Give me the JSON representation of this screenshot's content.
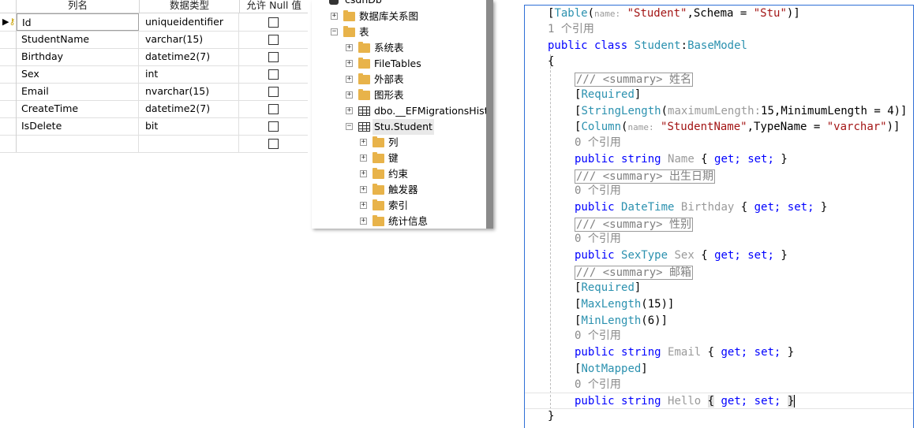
{
  "designer": {
    "headers": [
      "列名",
      "数据类型",
      "允许 Null 值"
    ],
    "rows": [
      {
        "name": "Id",
        "type": "uniqueidentifier",
        "nullable": false,
        "primary_key": true
      },
      {
        "name": "StudentName",
        "type": "varchar(15)",
        "nullable": false
      },
      {
        "name": "Birthday",
        "type": "datetime2(7)",
        "nullable": false
      },
      {
        "name": "Sex",
        "type": "int",
        "nullable": false
      },
      {
        "name": "Email",
        "type": "nvarchar(15)",
        "nullable": false
      },
      {
        "name": "CreateTime",
        "type": "datetime2(7)",
        "nullable": false
      },
      {
        "name": "IsDelete",
        "type": "bit",
        "nullable": false
      },
      {
        "name": "",
        "type": "",
        "nullable": false
      }
    ]
  },
  "tree": {
    "db_name": "csdnDb",
    "nodes": [
      {
        "label": "数据库关系图",
        "icon": "folder-icon"
      },
      {
        "label": "表",
        "icon": "folder-icon",
        "expanded": true
      },
      {
        "label": "系统表",
        "icon": "folder-icon"
      },
      {
        "label": "FileTables",
        "icon": "folder-icon"
      },
      {
        "label": "外部表",
        "icon": "folder-icon"
      },
      {
        "label": "图形表",
        "icon": "folder-icon"
      },
      {
        "label": "dbo.__EFMigrationsHistc",
        "icon": "table-icon"
      },
      {
        "label": "Stu.Student",
        "icon": "table-icon",
        "expanded": true
      },
      {
        "label": "列",
        "icon": "folder-icon"
      },
      {
        "label": "键",
        "icon": "folder-icon"
      },
      {
        "label": "约束",
        "icon": "folder-icon"
      },
      {
        "label": "触发器",
        "icon": "folder-icon"
      },
      {
        "label": "索引",
        "icon": "folder-icon"
      },
      {
        "label": "统计信息",
        "icon": "folder-icon"
      }
    ]
  },
  "code": {
    "table_attr": "Table",
    "name_hint": "name:",
    "table_name": "\"Student\"",
    "schema_text": ",Schema = ",
    "schema_value": "\"Stu\"",
    "ref_1": "1 个引用",
    "ref_0": "0 个引用",
    "kw_public": "public",
    "kw_class": "class",
    "class_name": "Student",
    "base_class": "BaseModel",
    "summary_prefix": "/// <summary>",
    "summary_name": "姓名",
    "summary_birthday": "出生日期",
    "summary_sex": "性别",
    "summary_email": "邮箱",
    "attr_required": "Required",
    "attr_stringlength": "StringLength",
    "max_length_hint": "maximumLength:",
    "stringlength_args": "15,MinimumLength = 4",
    "attr_column": "Column",
    "column_name": "\"StudentName\"",
    "column_type_text": ",TypeName = ",
    "column_type_value": "\"varchar\"",
    "kw_string": "string",
    "type_datetime": "DateTime",
    "type_sextype": "SexType",
    "attr_maxlength": "MaxLength",
    "maxlength_value": "15",
    "attr_minlength": "MinLength",
    "minlength_value": "6",
    "attr_notmapped": "NotMapped",
    "prop_name": "Name",
    "prop_birthday": "Birthday",
    "prop_sex": "Sex",
    "prop_email": "Email",
    "prop_hello": "Hello",
    "kw_get": "get;",
    "kw_set": "set;"
  }
}
